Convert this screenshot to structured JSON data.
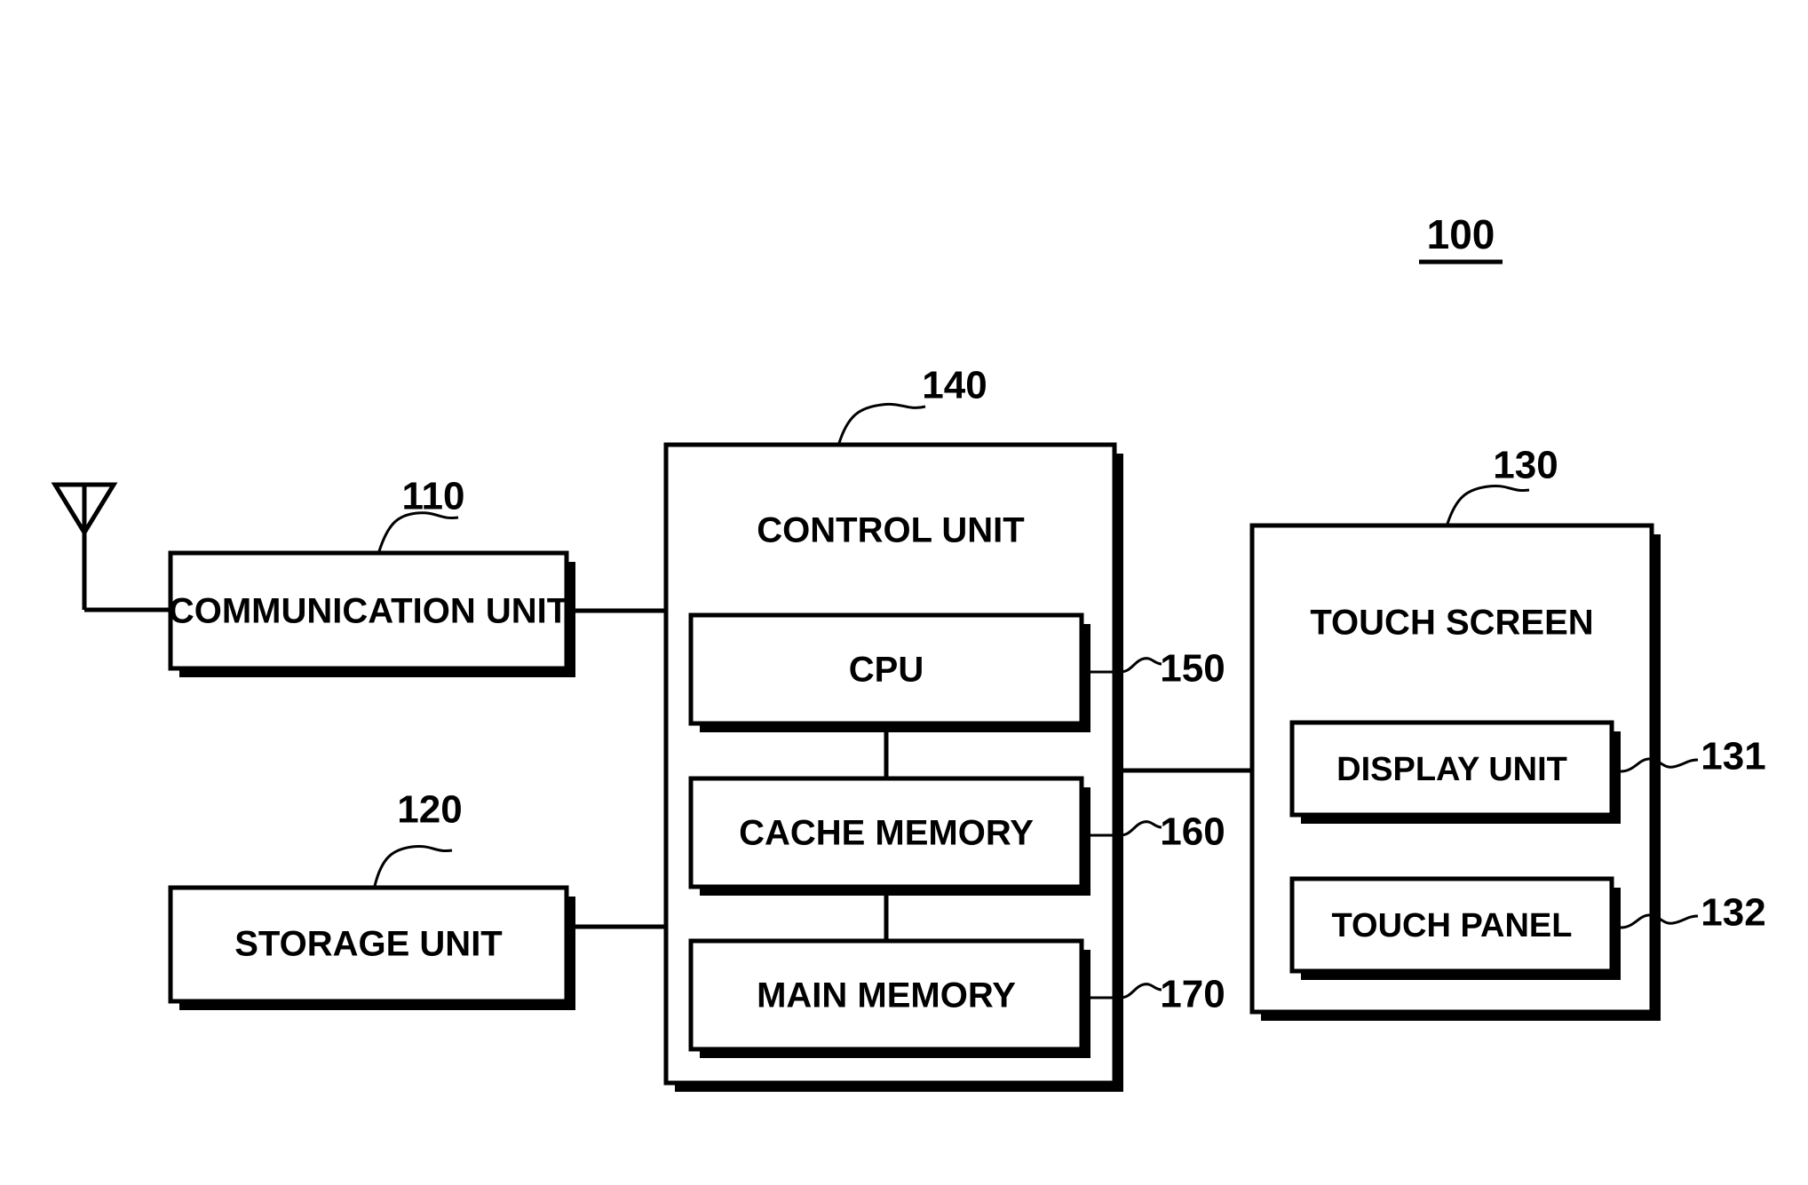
{
  "figure": {
    "type": "patent-block-diagram",
    "overall_ref": "100"
  },
  "blocks": {
    "communication_unit": {
      "label": "COMMUNICATION UNIT",
      "ref": "110"
    },
    "storage_unit": {
      "label": "STORAGE UNIT",
      "ref": "120"
    },
    "control_unit": {
      "label": "CONTROL UNIT",
      "ref": "140"
    },
    "cpu": {
      "label": "CPU",
      "ref": "150"
    },
    "cache_memory": {
      "label": "CACHE MEMORY",
      "ref": "160"
    },
    "main_memory": {
      "label": "MAIN MEMORY",
      "ref": "170"
    },
    "touch_screen": {
      "label": "TOUCH SCREEN",
      "ref": "130"
    },
    "display_unit": {
      "label": "DISPLAY UNIT",
      "ref": "131"
    },
    "touch_panel": {
      "label": "TOUCH PANEL",
      "ref": "132"
    },
    "antenna": {
      "label": "antenna-icon"
    }
  },
  "colors": {
    "line": "#000000",
    "fill": "#ffffff",
    "shadow": "#000000"
  }
}
